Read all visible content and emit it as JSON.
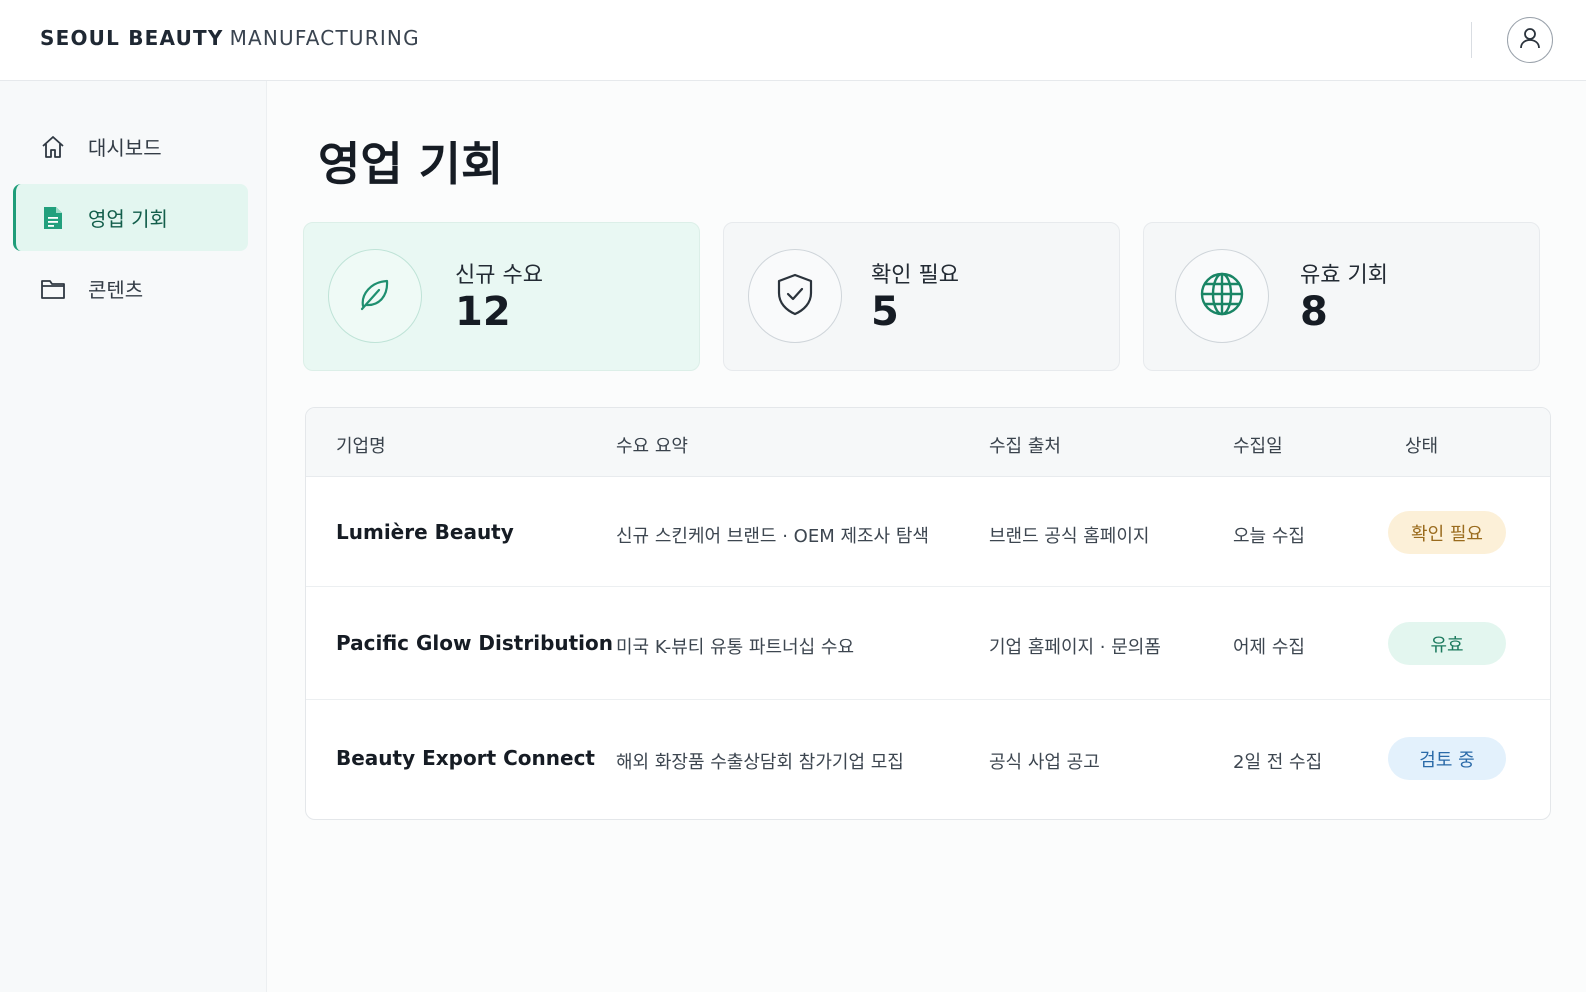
{
  "brand": {
    "bold": "SEOUL BEAUTY",
    "light": "MANUFACTURING"
  },
  "header": {
    "profile_icon": "user-icon"
  },
  "sidebar": {
    "items": [
      {
        "label": "대시보드",
        "icon": "home-icon",
        "active": false
      },
      {
        "label": "영업 기회",
        "icon": "document-icon",
        "active": true
      },
      {
        "label": "콘텐츠",
        "icon": "folder-icon",
        "active": false
      }
    ]
  },
  "page": {
    "title": "영업 기회"
  },
  "stats": [
    {
      "label": "신규 수요",
      "value": "12",
      "icon": "leaf-icon"
    },
    {
      "label": "확인 필요",
      "value": "5",
      "icon": "shield-check-icon"
    },
    {
      "label": "유효 기회",
      "value": "8",
      "icon": "globe-icon"
    }
  ],
  "table": {
    "headers": [
      "기업명",
      "수요 요약",
      "수집 출처",
      "수집일",
      "상태"
    ],
    "rows": [
      {
        "company": "Lumière Beauty",
        "summary": "신규 스킨케어 브랜드 · OEM 제조사 탐색",
        "source": "브랜드 공식 홈페이지",
        "date": "오늘 수집",
        "status": "확인 필요"
      },
      {
        "company": "Pacific Glow Distribution",
        "summary": "미국 K-뷰티 유통 파트너십 수요",
        "source": "기업 홈페이지 · 문의폼",
        "date": "어제 수집",
        "status": "유효"
      },
      {
        "company": "Beauty Export Connect",
        "summary": "해외 화장품 수출상담회 참가기업 모집",
        "source": "공식 사업 공고",
        "date": "2일 전 수집",
        "status": "검토 중"
      }
    ]
  },
  "colors": {
    "accent": "#1f9d79",
    "status_warning_bg": "#fcf0d8",
    "status_warning_text": "#9a6b1d",
    "status_valid_bg": "#e3f6ef",
    "status_valid_text": "#1c7a5e",
    "status_review_bg": "#e3f1fc",
    "status_review_text": "#2a6aa8"
  }
}
